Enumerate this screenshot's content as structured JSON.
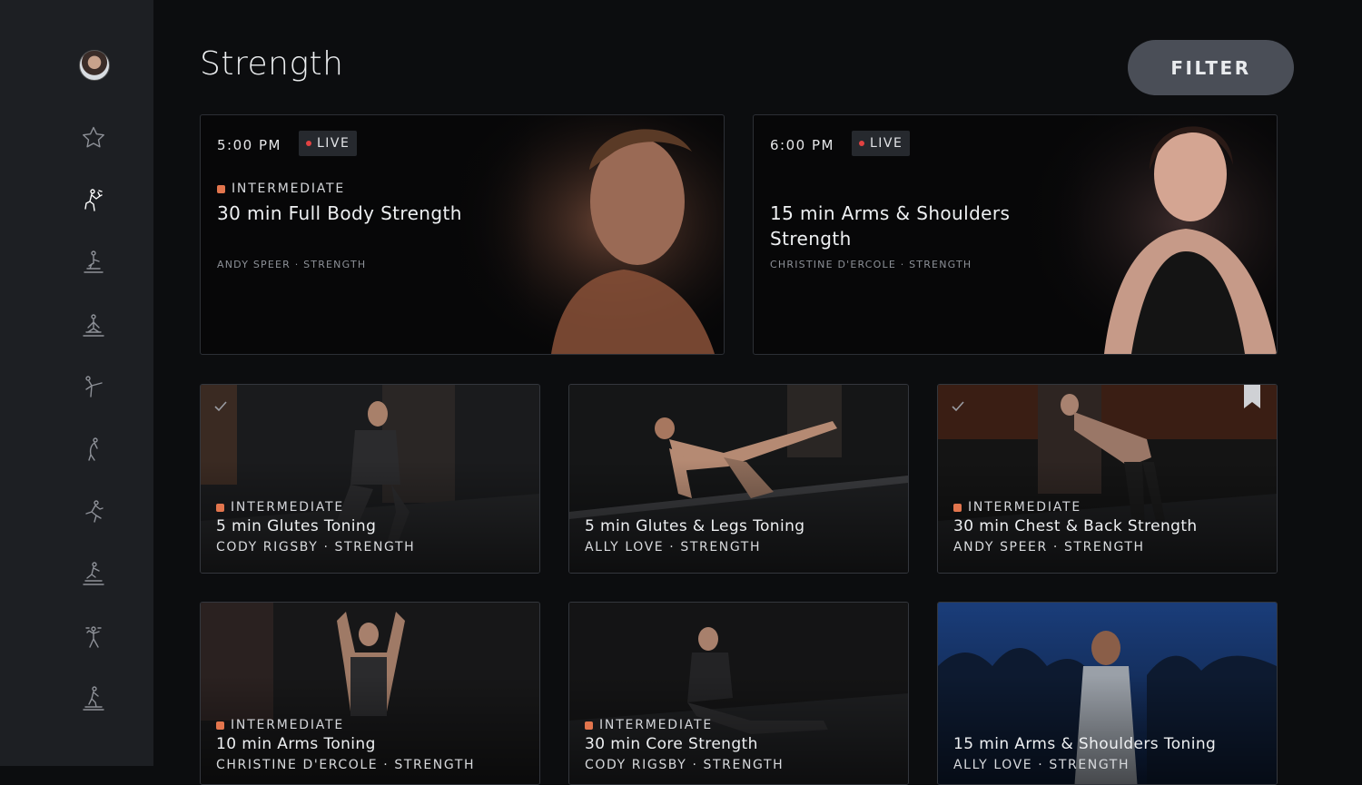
{
  "sidebar": {
    "items": [
      {
        "icon": "favorites-star-icon"
      },
      {
        "icon": "strength-icon",
        "active": true
      },
      {
        "icon": "cycling-icon"
      },
      {
        "icon": "meditation-icon"
      },
      {
        "icon": "yoga-icon"
      },
      {
        "icon": "stretching-icon"
      },
      {
        "icon": "running-icon"
      },
      {
        "icon": "bootcamp-icon"
      },
      {
        "icon": "cardio-icon"
      },
      {
        "icon": "walking-icon"
      }
    ]
  },
  "header": {
    "title": "Strength",
    "filter_label": "FILTER"
  },
  "live_classes": [
    {
      "time": "5:00 PM",
      "badge": "LIVE",
      "level": "INTERMEDIATE",
      "title": "30 min Full Body Strength",
      "instructor": "ANDY SPEER · STRENGTH"
    },
    {
      "time": "6:00 PM",
      "badge": "LIVE",
      "level": "",
      "title_line1": "15 min Arms & Shoulders",
      "title_line2": "Strength",
      "instructor": "CHRISTINE D'ERCOLE · STRENGTH"
    }
  ],
  "classes": [
    {
      "level": "INTERMEDIATE",
      "title": "5 min Glutes Toning",
      "instructor": "CODY RIGSBY · STRENGTH",
      "completed": true
    },
    {
      "level": "",
      "title": "5 min Glutes & Legs Toning",
      "instructor": "ALLY LOVE · STRENGTH",
      "completed": false
    },
    {
      "level": "INTERMEDIATE",
      "title": "30 min Chest & Back Strength",
      "instructor": "ANDY SPEER · STRENGTH",
      "completed": true,
      "bookmarked": true
    },
    {
      "level": "INTERMEDIATE",
      "title": "10 min Arms Toning",
      "instructor": "CHRISTINE D'ERCOLE · STRENGTH"
    },
    {
      "level": "INTERMEDIATE",
      "title": "30 min Core Strength",
      "instructor": "CODY RIGSBY · STRENGTH"
    },
    {
      "level": "",
      "title": "15 min Arms & Shoulders Toning",
      "instructor": "ALLY LOVE · STRENGTH"
    }
  ],
  "colors": {
    "level_dot": "#e2754d",
    "live_dot": "#e24242",
    "sidebar_bg": "#1d1f23",
    "filter_bg": "#4a4e57"
  }
}
